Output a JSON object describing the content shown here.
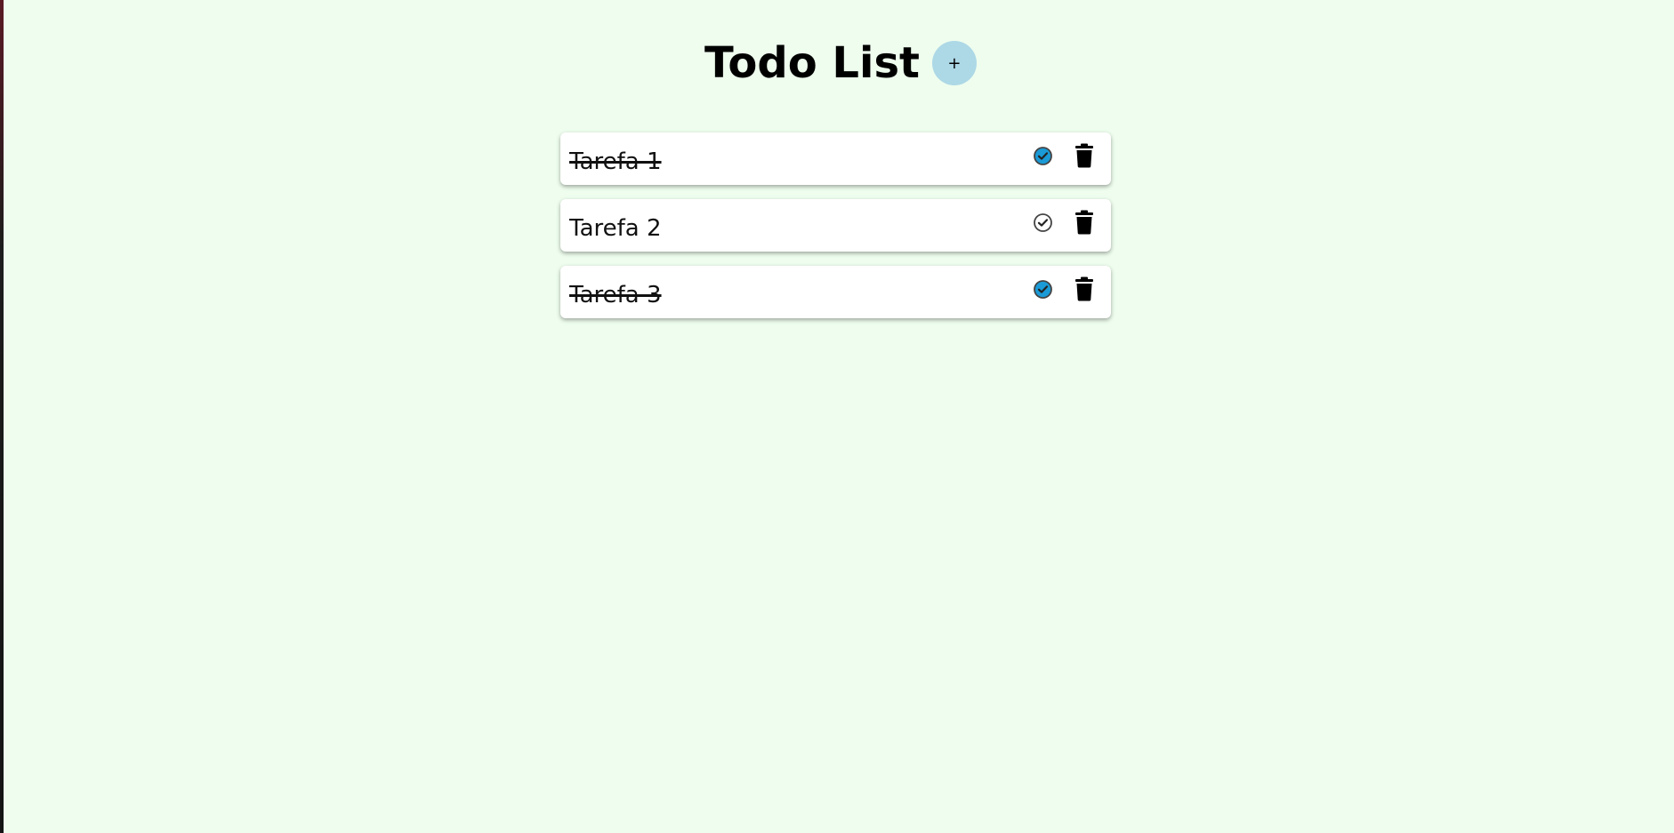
{
  "header": {
    "title": "Todo List",
    "add_label": "+"
  },
  "todos": [
    {
      "text": "Tarefa 1",
      "completed": true
    },
    {
      "text": "Tarefa 2",
      "completed": false
    },
    {
      "text": "Tarefa 3",
      "completed": true
    }
  ],
  "colors": {
    "background": "#eefdee",
    "add_button": "#add8e6",
    "check_done": "#1a9ad6",
    "check_pending": "#ffffff"
  },
  "icons": {
    "check": "check-circle-icon",
    "delete": "trash-icon"
  }
}
